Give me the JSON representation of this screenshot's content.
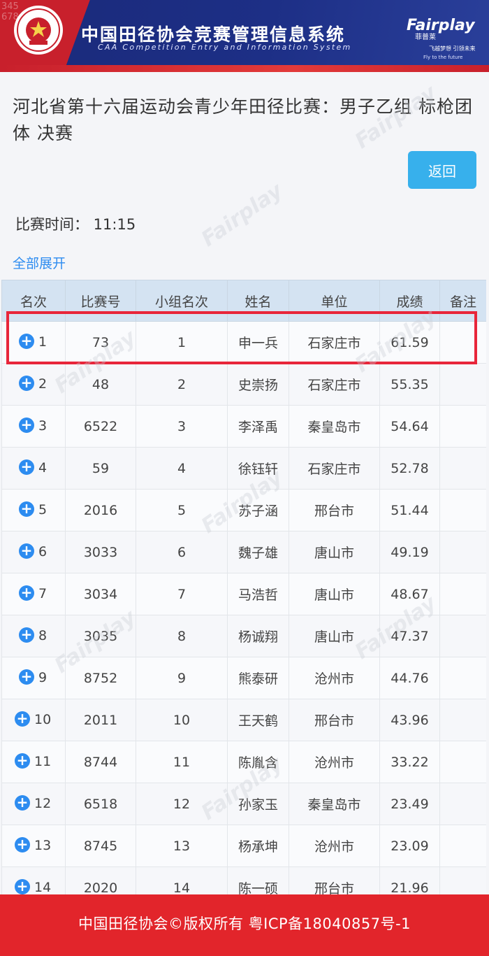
{
  "banner": {
    "track_numbers": "345678",
    "logo_text": "CHINESE ATHLETICS ASSOCIATION",
    "logo_cn": "中国田径协会",
    "title": "中国田径协会竞赛管理信息系统",
    "subtitle": "CAA Competition Entry and Information System",
    "brand": "Fairplay",
    "brand_cn": "菲普莱",
    "slogan": "飞越梦想 引领未来",
    "slogan_en": "Fly to the future"
  },
  "page": {
    "title": "河北省第十六届运动会青少年田径比赛：男子乙组 标枪团体 决赛",
    "back_label": "返回",
    "match_time": "比赛时间：  11:15",
    "expand_label": "全部展开"
  },
  "table": {
    "headers": [
      "名次",
      "比赛号",
      "小组名次",
      "姓名",
      "单位",
      "成绩",
      "备注"
    ],
    "rows": [
      {
        "rank": "1",
        "bib": "73",
        "group_rank": "1",
        "name": "申一兵",
        "unit": "石家庄市",
        "score": "61.59",
        "note": ""
      },
      {
        "rank": "2",
        "bib": "48",
        "group_rank": "2",
        "name": "史崇扬",
        "unit": "石家庄市",
        "score": "55.35",
        "note": ""
      },
      {
        "rank": "3",
        "bib": "6522",
        "group_rank": "3",
        "name": "李泽禹",
        "unit": "秦皇岛市",
        "score": "54.64",
        "note": ""
      },
      {
        "rank": "4",
        "bib": "59",
        "group_rank": "4",
        "name": "徐钰轩",
        "unit": "石家庄市",
        "score": "52.78",
        "note": ""
      },
      {
        "rank": "5",
        "bib": "2016",
        "group_rank": "5",
        "name": "苏子涵",
        "unit": "邢台市",
        "score": "51.44",
        "note": ""
      },
      {
        "rank": "6",
        "bib": "3033",
        "group_rank": "6",
        "name": "魏子雄",
        "unit": "唐山市",
        "score": "49.19",
        "note": ""
      },
      {
        "rank": "7",
        "bib": "3034",
        "group_rank": "7",
        "name": "马浩哲",
        "unit": "唐山市",
        "score": "48.67",
        "note": ""
      },
      {
        "rank": "8",
        "bib": "3035",
        "group_rank": "8",
        "name": "杨诚翔",
        "unit": "唐山市",
        "score": "47.37",
        "note": ""
      },
      {
        "rank": "9",
        "bib": "8752",
        "group_rank": "9",
        "name": "熊泰研",
        "unit": "沧州市",
        "score": "44.76",
        "note": ""
      },
      {
        "rank": "10",
        "bib": "2011",
        "group_rank": "10",
        "name": "王天鹤",
        "unit": "邢台市",
        "score": "43.96",
        "note": ""
      },
      {
        "rank": "11",
        "bib": "8744",
        "group_rank": "11",
        "name": "陈胤含",
        "unit": "沧州市",
        "score": "33.22",
        "note": ""
      },
      {
        "rank": "12",
        "bib": "6518",
        "group_rank": "12",
        "name": "孙家玉",
        "unit": "秦皇岛市",
        "score": "23.49",
        "note": ""
      },
      {
        "rank": "13",
        "bib": "8745",
        "group_rank": "13",
        "name": "杨承坤",
        "unit": "沧州市",
        "score": "23.09",
        "note": ""
      },
      {
        "rank": "14",
        "bib": "2020",
        "group_rank": "14",
        "name": "陈一硕",
        "unit": "邢台市",
        "score": "21.96",
        "note": ""
      }
    ]
  },
  "watermark": "Fairplay",
  "footer": {
    "text": "中国田径协会©版权所有  粤ICP备18040857号-1"
  },
  "colors": {
    "banner_blue": "#1d2f86",
    "banner_red": "#c8202c",
    "accent_blue": "#2d8cf0",
    "button_blue": "#37b0ec",
    "highlight_red": "#e8263a",
    "footer_red": "#e2252b",
    "header_bg": "#d4e3f2"
  },
  "icons": {
    "expand_row": "plus-circle-icon"
  }
}
